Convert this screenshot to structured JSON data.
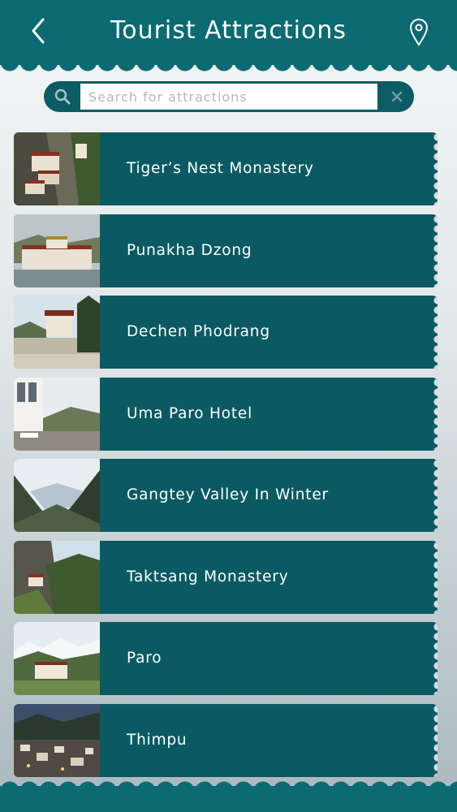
{
  "header": {
    "title": "Tourist Attractions",
    "back_icon": "back-chevron-icon",
    "location_icon": "map-pin-icon",
    "color": "#0b6a72"
  },
  "search": {
    "placeholder": "Search for attractions",
    "value": "",
    "search_icon": "search-icon",
    "clear_icon": "close-icon"
  },
  "attractions": [
    {
      "label": "Tiger’s Nest Monastery",
      "image": "cliffside-monastery"
    },
    {
      "label": "Punakha Dzong",
      "image": "riverside-fortress"
    },
    {
      "label": "Dechen Phodrang",
      "image": "hilltop-monastery"
    },
    {
      "label": "Uma Paro Hotel",
      "image": "hotel-terrace"
    },
    {
      "label": "Gangtey Valley In Winter",
      "image": "snowy-valley"
    },
    {
      "label": "Taktsang Monastery",
      "image": "cliffside-monastery-2"
    },
    {
      "label": "Paro",
      "image": "mountain-town"
    },
    {
      "label": "Thimpu",
      "image": "city-at-dusk"
    }
  ],
  "colors": {
    "accent": "#0b6a72",
    "item_bg": "#0b5a63"
  }
}
